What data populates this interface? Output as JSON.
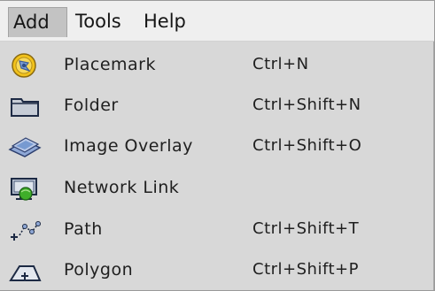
{
  "menubar": {
    "items": [
      {
        "label": "Add",
        "state": "open"
      },
      {
        "label": "Tools"
      },
      {
        "label": "Help"
      }
    ]
  },
  "dropdown": {
    "items": [
      {
        "label": "Placemark",
        "shortcut": "Ctrl+N",
        "icon": "placemark-icon"
      },
      {
        "label": "Folder",
        "shortcut": "Ctrl+Shift+N",
        "icon": "folder-icon"
      },
      {
        "label": "Image Overlay",
        "shortcut": "Ctrl+Shift+O",
        "icon": "image-overlay-icon"
      },
      {
        "label": "Network Link",
        "shortcut": "",
        "icon": "network-link-icon"
      },
      {
        "label": "Path",
        "shortcut": "Ctrl+Shift+T",
        "icon": "path-icon"
      },
      {
        "label": "Polygon",
        "shortcut": "Ctrl+Shift+P",
        "icon": "polygon-icon"
      }
    ]
  },
  "colors": {
    "menubar_bg": "#efefef",
    "menu_bg": "#d8d8d8",
    "open_menu_bg": "#c3c3c3",
    "placemark_yellow": "#f2c21b",
    "network_green": "#3fae2a",
    "overlay_blue": "#5b86c8"
  }
}
